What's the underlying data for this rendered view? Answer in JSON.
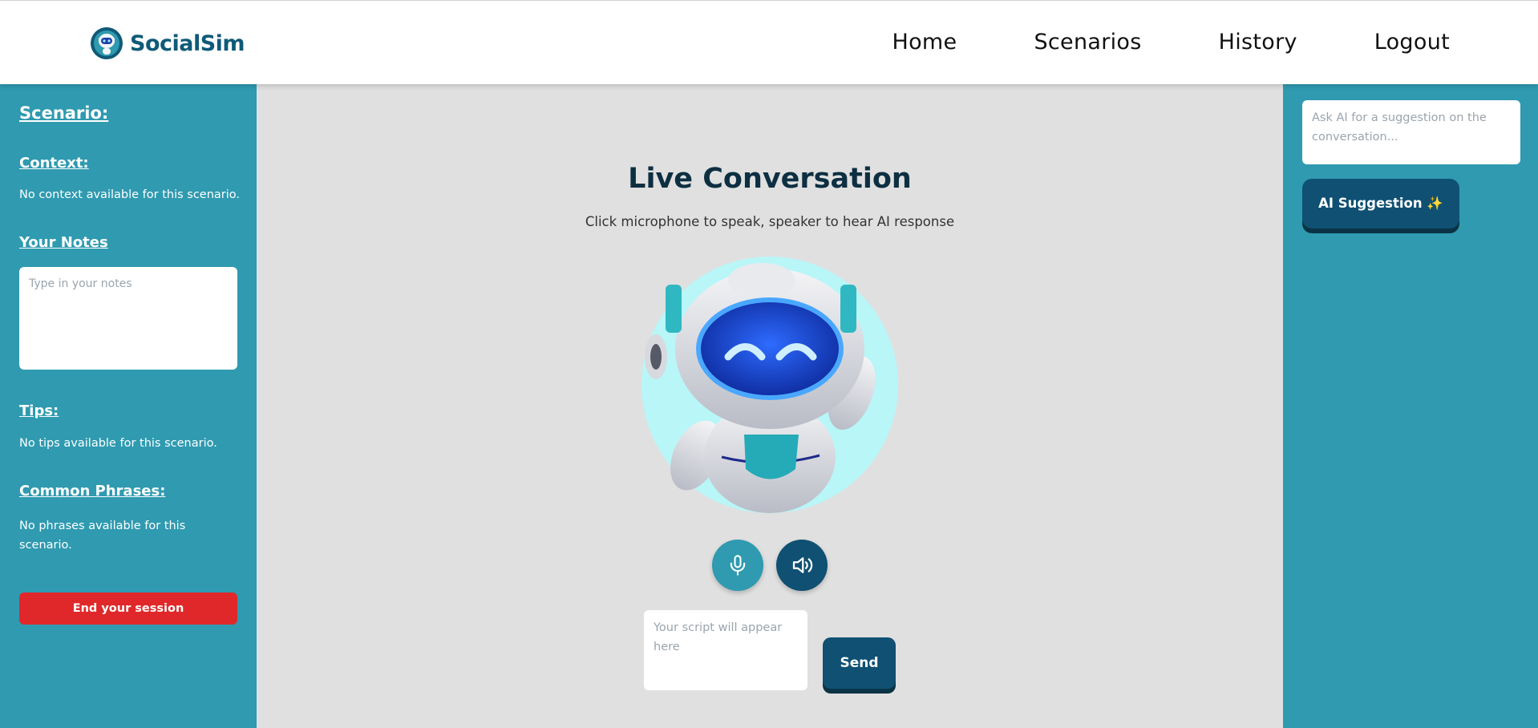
{
  "header": {
    "brand": "SocialSim",
    "nav": [
      "Home",
      "Scenarios",
      "History",
      "Logout"
    ]
  },
  "left_sidebar": {
    "scenario_heading": "Scenario:",
    "context_heading": "Context:",
    "context_text": "No context available for this scenario.",
    "notes_heading": "Your Notes",
    "notes_placeholder": "Type in your notes",
    "tips_heading": "Tips:",
    "tips_text": "No tips available for this scenario.",
    "phrases_heading": "Common Phrases:",
    "phrases_text": "No phrases available for this scenario.",
    "end_session_label": "End your session"
  },
  "main": {
    "title": "Live Conversation",
    "subtitle": "Click microphone to speak, speaker to hear AI response",
    "robot_icon": "robot-mascot-icon",
    "mic_icon": "microphone-icon",
    "speaker_icon": "speaker-icon",
    "script_placeholder": "Your script will appear here",
    "send_label": "Send"
  },
  "right_sidebar": {
    "ask_placeholder": "Ask AI for a suggestion on the conversation...",
    "suggestion_label": "AI Suggestion ✨"
  },
  "colors": {
    "teal": "#2f9ab0",
    "navy": "#0f5073",
    "danger": "#e0282a",
    "background": "#e0e0e0"
  }
}
